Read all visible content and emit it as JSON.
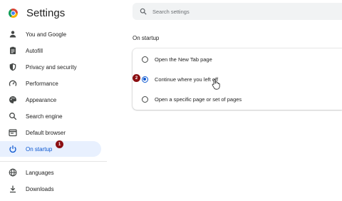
{
  "app": {
    "title": "Settings"
  },
  "search": {
    "placeholder": "Search settings"
  },
  "sidebar": {
    "items": [
      {
        "label": "You and Google",
        "icon": "person-icon"
      },
      {
        "label": "Autofill",
        "icon": "clipboard-icon"
      },
      {
        "label": "Privacy and security",
        "icon": "shield-icon"
      },
      {
        "label": "Performance",
        "icon": "speedometer-icon"
      },
      {
        "label": "Appearance",
        "icon": "palette-icon"
      },
      {
        "label": "Search engine",
        "icon": "search-icon"
      },
      {
        "label": "Default browser",
        "icon": "browser-icon"
      },
      {
        "label": "On startup",
        "icon": "power-icon",
        "active": true
      },
      {
        "label": "Languages",
        "icon": "globe-icon"
      },
      {
        "label": "Downloads",
        "icon": "download-icon"
      }
    ]
  },
  "main": {
    "section_title": "On startup",
    "options": [
      {
        "label": "Open the New Tab page",
        "checked": false
      },
      {
        "label": "Continue where you left off",
        "checked": true
      },
      {
        "label": "Open a specific page or set of pages",
        "checked": false
      }
    ]
  },
  "annotations": {
    "badge_1": "1",
    "badge_2": "2"
  },
  "colors": {
    "accent": "#0b57d0",
    "active_bg": "#e8f0fe",
    "badge": "#8b0f12"
  }
}
